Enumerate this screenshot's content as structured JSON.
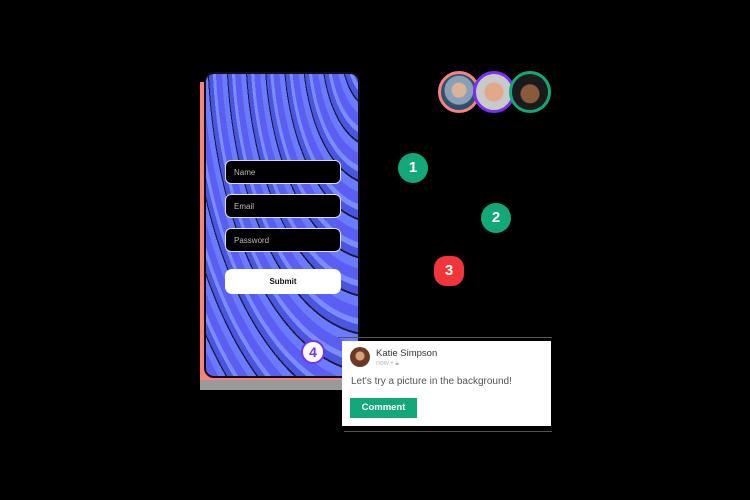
{
  "form": {
    "name_placeholder": "Name",
    "email_placeholder": "Email",
    "password_placeholder": "Password",
    "submit_label": "Submit"
  },
  "markers": [
    {
      "label": "1",
      "color": "#12a87a"
    },
    {
      "label": "2",
      "color": "#12a87a"
    },
    {
      "label": "3",
      "color": "#f2353a"
    },
    {
      "label": "4",
      "color": "#7b2ff2"
    }
  ],
  "avatars": [
    {
      "ring": "#f9827a"
    },
    {
      "ring": "#7b2ff2"
    },
    {
      "ring": "#12a87a"
    }
  ],
  "comment": {
    "author": "Katie Simpson",
    "time": "now",
    "separator": "•",
    "text": "Let's try a picture in the background!",
    "button_label": "Comment",
    "button_color": "#12a87a"
  }
}
